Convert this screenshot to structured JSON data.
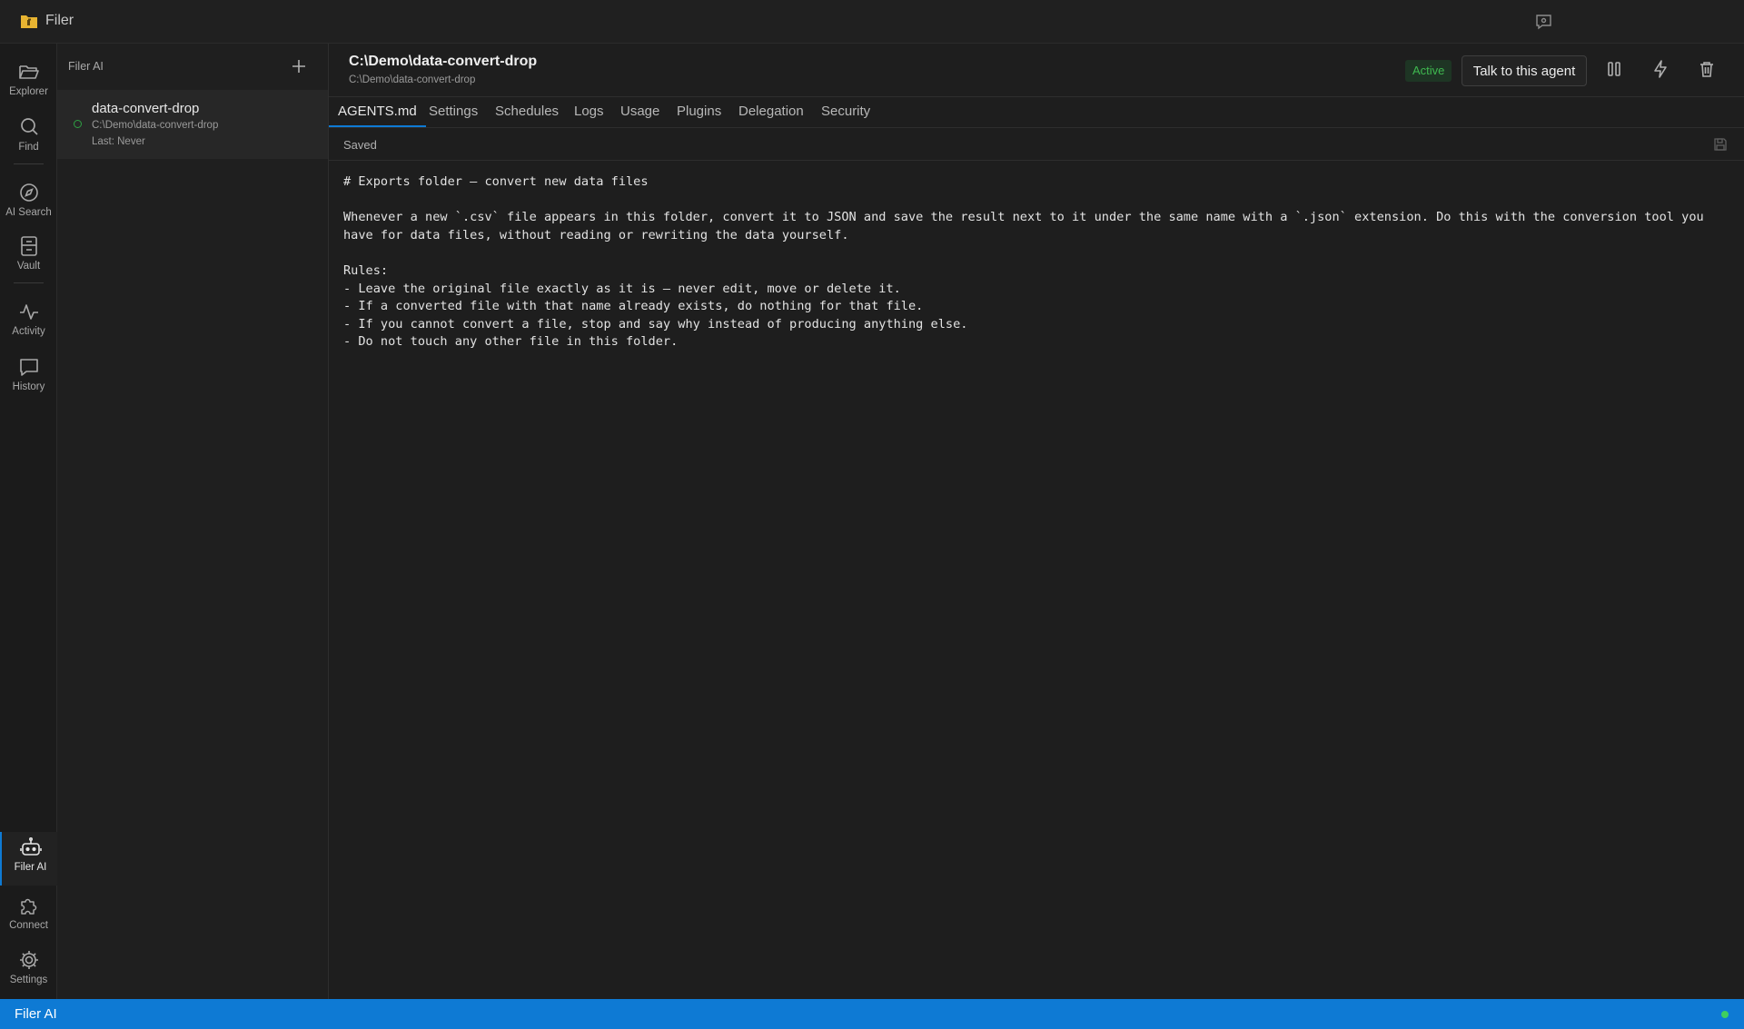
{
  "app": {
    "title": "Filer"
  },
  "activity_bar": {
    "items": [
      {
        "label": "Explorer",
        "icon": "folder-open-icon"
      },
      {
        "label": "Find",
        "icon": "search-icon"
      },
      {
        "label": "AI Search",
        "icon": "compass-icon"
      },
      {
        "label": "Vault",
        "icon": "vault-icon"
      },
      {
        "label": "Activity",
        "icon": "activity-pulse-icon"
      },
      {
        "label": "History",
        "icon": "chat-history-icon"
      }
    ],
    "bottom_items": [
      {
        "label": "Filer AI",
        "icon": "robot-icon",
        "active": true
      },
      {
        "label": "Connect",
        "icon": "puzzle-icon"
      },
      {
        "label": "Settings",
        "icon": "gear-icon"
      }
    ]
  },
  "side_panel": {
    "header": "Filer AI",
    "agents": [
      {
        "name": "data-convert-drop",
        "path": "C:\\Demo\\data-convert-drop",
        "last_run": "Last: Never",
        "status_color": "#2ea043"
      }
    ]
  },
  "main": {
    "title": "C:\\Demo\\data-convert-drop",
    "subtitle": "C:\\Demo\\data-convert-drop",
    "status": "Active",
    "talk_button": "Talk to this agent",
    "tabs": [
      "AGENTS.md",
      "Settings",
      "Schedules",
      "Logs",
      "Usage",
      "Plugins",
      "Delegation",
      "Security"
    ],
    "active_tab": "AGENTS.md",
    "save_status": "Saved",
    "editor_content": "# Exports folder — convert new data files\n\nWhenever a new `.csv` file appears in this folder, convert it to JSON and save the result next to it under the same name with a `.json` extension. Do this with the conversion tool you have for data files, without reading or rewriting the data yourself.\n\nRules:\n- Leave the original file exactly as it is — never edit, move or delete it.\n- If a converted file with that name already exists, do nothing for that file.\n- If you cannot convert a file, stop and say why instead of producing anything else.\n- Do not touch any other file in this folder."
  },
  "status_bar": {
    "text": "Filer AI"
  },
  "colors": {
    "accent": "#0e7ad4",
    "active_green": "#3fb950",
    "background": "#1e1e1e"
  }
}
